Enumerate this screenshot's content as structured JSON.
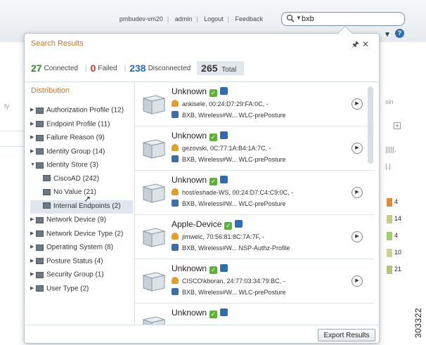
{
  "topbar": {
    "user_host": "pmbudev-vm20",
    "admin_link": "admin",
    "logout_link": "Logout",
    "feedback_link": "Feedback",
    "search_value": "bxb"
  },
  "background": {
    "left_label": "ty",
    "right_label": "sin",
    "right_bars": [
      {
        "value": "4",
        "color": "#e08a3c"
      },
      {
        "value": "14",
        "color": "#c9c98a"
      },
      {
        "value": "4",
        "color": "#9fcf6a"
      },
      {
        "value": "10",
        "color": "#cfcf9a"
      },
      {
        "value": "21",
        "color": "#b9c27a"
      }
    ],
    "code": "303322"
  },
  "popup": {
    "title": "Search Results",
    "pin_icon": "pin-icon",
    "close_icon": "close-icon"
  },
  "summary": {
    "connected_count": "27",
    "connected_label": "Connected",
    "failed_count": "0",
    "failed_label": "Failed",
    "disconnected_count": "238",
    "disconnected_label": "Disconnected",
    "total_count": "265",
    "total_label": "Total",
    "colors": {
      "connected": "#2f8a1f",
      "failed": "#c0392b",
      "disconnected": "#2a6db5"
    }
  },
  "distribution": {
    "header": "Distribution",
    "items": [
      {
        "label": "Authorization Profile (12)",
        "expanded": false
      },
      {
        "label": "Endpoint Profile (11)",
        "expanded": false
      },
      {
        "label": "Failure Reason (9)",
        "expanded": false
      },
      {
        "label": "Identity Group (14)",
        "expanded": false
      },
      {
        "label": "Identity Store (3)",
        "expanded": true
      },
      {
        "label": "CiscoAD (242)",
        "child": true
      },
      {
        "label": "No Value (21)",
        "child": true
      },
      {
        "label": "Internal Endpoints (2)",
        "child": true,
        "selected": true
      },
      {
        "label": "Network Device (9)",
        "expanded": false
      },
      {
        "label": "Network Device Type (2)",
        "expanded": false
      },
      {
        "label": "Operating System (8)",
        "expanded": false
      },
      {
        "label": "Posture Status (4)",
        "expanded": false
      },
      {
        "label": "Security Group (1)",
        "expanded": false
      },
      {
        "label": "User Type (2)",
        "expanded": false
      }
    ]
  },
  "results": [
    {
      "title": "Unknown",
      "line1": "ankisele, 00:24:D7:29:FA:0C, -",
      "line2": "BXB, Wireless#W... WLC-prePosture"
    },
    {
      "title": "Unknown",
      "line1": "gezovski, 0C:77:1A:B4:1A:7C, -",
      "line2": "BXB, Wireless#W... WLC-prePosture"
    },
    {
      "title": "Unknown",
      "line1": "host/eshade-WS, 00:24:D7:C4:C9:0C, -",
      "line2": "BXB, Wireless#W... WLC-prePosture"
    },
    {
      "title": "Apple-Device",
      "line1": "jimweic, 70:56:81:8C:7A:7F, -",
      "line2": "BXB, Wireless#W... NSP-Authz-Profile"
    },
    {
      "title": "Unknown",
      "line1": "CISCO\\kboran, 24:77:03:34:79:BC, -",
      "line2": "BXB, Wireless#W... WLC-prePosture"
    },
    {
      "title": "Unknown",
      "line1": "",
      "line2": ""
    }
  ],
  "export_button": "Export Results"
}
